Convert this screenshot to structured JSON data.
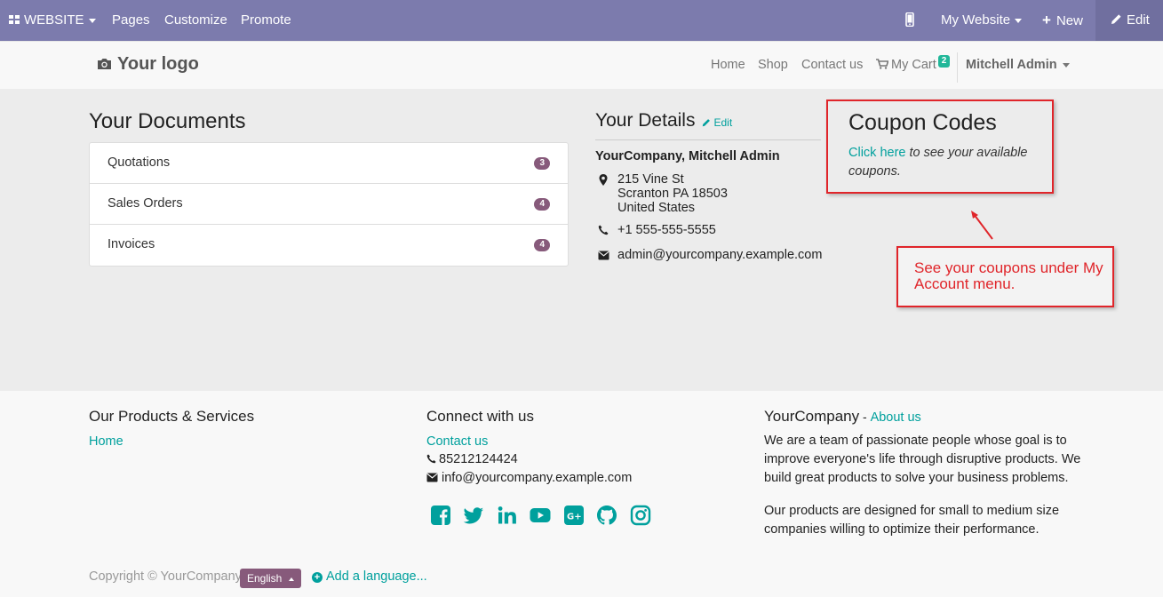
{
  "adminbar": {
    "website_label": "WEBSITE",
    "pages": "Pages",
    "customize": "Customize",
    "promote": "Promote",
    "my_website": "My Website",
    "new": "New",
    "edit": "Edit"
  },
  "header": {
    "logo": "Your logo",
    "nav": [
      "Home",
      "Shop",
      "Contact us"
    ],
    "cart_label": "My Cart",
    "cart_count": "2",
    "user": "Mitchell Admin"
  },
  "documents": {
    "title": "Your Documents",
    "items": [
      {
        "label": "Quotations",
        "count": "3"
      },
      {
        "label": "Sales Orders",
        "count": "4"
      },
      {
        "label": "Invoices",
        "count": "4"
      }
    ]
  },
  "details": {
    "title": "Your Details",
    "edit": "Edit",
    "name": "YourCompany, Mitchell Admin",
    "address": [
      "215 Vine St",
      "Scranton PA 18503",
      "United States"
    ],
    "phone": "+1 555-555-5555",
    "email": "admin@yourcompany.example.com"
  },
  "coupon": {
    "title": "Coupon Codes",
    "link": "Click here",
    "text": " to see your available coupons."
  },
  "annotation": {
    "note": "See your coupons under My Account menu.",
    "color": "#e0252a"
  },
  "footer": {
    "col1": {
      "title": "Our Products & Services",
      "link": "Home"
    },
    "col2": {
      "title": "Connect with us",
      "link": "Contact us",
      "phone": "85212124424",
      "email": "info@yourcompany.example.com"
    },
    "col3": {
      "title": "YourCompany",
      "title_sep": " - ",
      "about": "About us",
      "p1": [
        "We are a team of passionate people whose goal is to",
        "improve everyone's life through disruptive products. We",
        "build great products to solve your business problems."
      ],
      "p2": [
        "Our products are designed for small to medium size",
        "companies willing to optimize their performance."
      ]
    },
    "social": [
      "facebook-icon",
      "twitter-icon",
      "linkedin-icon",
      "youtube-icon",
      "google-plus-icon",
      "github-icon",
      "instagram-icon"
    ],
    "copyright": "Copyright © YourCompany",
    "language": "English",
    "add_language": "Add a language..."
  },
  "colors": {
    "adminbar": "#7c7bad",
    "accent": "#00a09d",
    "badge": "#875a7b"
  }
}
